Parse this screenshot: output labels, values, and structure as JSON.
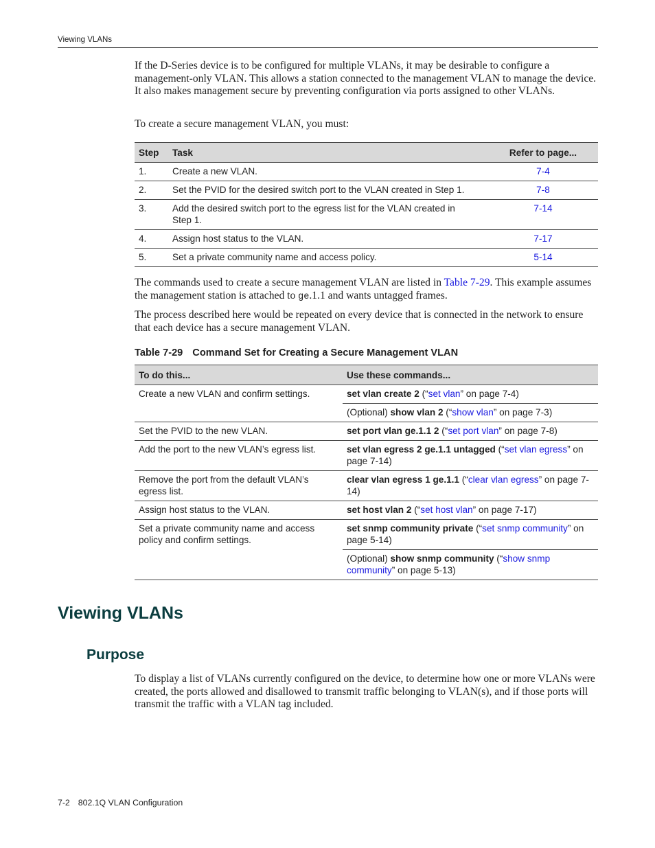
{
  "header": {
    "running_title": "Viewing VLANs"
  },
  "intro": {
    "paragraph1": "If the D-Series device is to be configured for multiple VLANs, it may be desirable to configure a management-only VLAN. This allows a station connected to the management VLAN to manage the device. It also makes management secure by preventing configuration via ports assigned to other VLANs.",
    "paragraph2": "To create a secure management VLAN, you must:"
  },
  "steps_table": {
    "headers": {
      "step": "Step",
      "task": "Task",
      "ref": "Refer to page..."
    },
    "rows": [
      {
        "step": "1.",
        "task": "Create a new VLAN.",
        "ref": "7-4"
      },
      {
        "step": "2.",
        "task": "Set the PVID for the desired switch port to the VLAN created in Step 1.",
        "ref": "7-8"
      },
      {
        "step": "3.",
        "task": "Add the desired switch port to the egress list for the VLAN created in Step 1.",
        "ref": "7-14"
      },
      {
        "step": "4.",
        "task": "Assign host status to the VLAN.",
        "ref": "7-17"
      },
      {
        "step": "5.",
        "task": "Set a private community name and access policy.",
        "ref": "5-14"
      }
    ]
  },
  "middle": {
    "p3_before": "The commands used to create a secure management VLAN are listed in ",
    "p3_link": "Table 7-29",
    "p3_after1": ". This example assumes the management station is attached to ",
    "p3_code": "ge",
    "p3_after2": ".1.1 and wants untagged frames.",
    "paragraph4": "The process described here would be repeated on every device that is connected in the network to ensure that each device has a secure management VLAN."
  },
  "table_caption": {
    "number": "Table 7-29",
    "title": "Command Set for Creating a Secure Management VLAN"
  },
  "cmd_table": {
    "headers": {
      "task": "To do this...",
      "commands": "Use these commands..."
    },
    "rows": [
      {
        "task": "Create a new VLAN and confirm settings.",
        "c1": {
          "prefix": "",
          "bold": "set vlan create 2",
          "open": " (“",
          "link": "set vlan",
          "close": "” on page 7-4)"
        },
        "c2": {
          "prefix": "(Optional) ",
          "bold": "show vlan 2",
          "open": " (“",
          "link": "show vlan",
          "close": "” on page 7-3)"
        }
      },
      {
        "task": "Set the PVID to the new VLAN.",
        "c1": {
          "prefix": "",
          "bold": "set port vlan ge.1.1 2",
          "open": " (“",
          "link": "set port vlan",
          "close": "” on page 7-8)"
        }
      },
      {
        "task": "Add the port to the new VLAN’s egress list.",
        "c1": {
          "prefix": "",
          "bold": "set vlan egress 2 ge.1.1 untagged",
          "open": " (“",
          "link": "set vlan egress",
          "close": "” on page 7-14)"
        }
      },
      {
        "task": "Remove the port from the default VLAN’s egress list.",
        "c1": {
          "prefix": "",
          "bold": "clear vlan egress 1 ge.1.1",
          "open": " (“",
          "link": "clear vlan egress",
          "close": "” on page 7-14)"
        }
      },
      {
        "task": "Assign host status to the VLAN.",
        "c1": {
          "prefix": "",
          "bold": "set host vlan 2",
          "open": " (“",
          "link": "set host vlan",
          "close": "” on page 7-17)"
        }
      },
      {
        "task": "Set a private community name and access policy and confirm settings.",
        "c1": {
          "prefix": "",
          "bold": "set snmp community private",
          "open": " (“",
          "link": "set snmp community",
          "close": "” on page 5-14)"
        },
        "c2": {
          "prefix": "(Optional) ",
          "bold": "show snmp community",
          "open": " (“",
          "link": "show snmp community",
          "close": "” on page 5-13)"
        }
      }
    ]
  },
  "section": {
    "heading": "Viewing VLANs",
    "subheading": "Purpose",
    "paragraph": "To display a list of VLANs currently configured on the device, to determine how one or more VLANs were created, the ports allowed and disallowed to transmit traffic belonging to VLAN(s), and if those ports will transmit the traffic with a VLAN tag included."
  },
  "footer": {
    "page": "7-2",
    "chapter": "802.1Q VLAN Configuration"
  },
  "colors": {
    "link": "#1a1adf",
    "heading": "#0b3d3f",
    "table_header_bg": "#d9d9d9"
  }
}
